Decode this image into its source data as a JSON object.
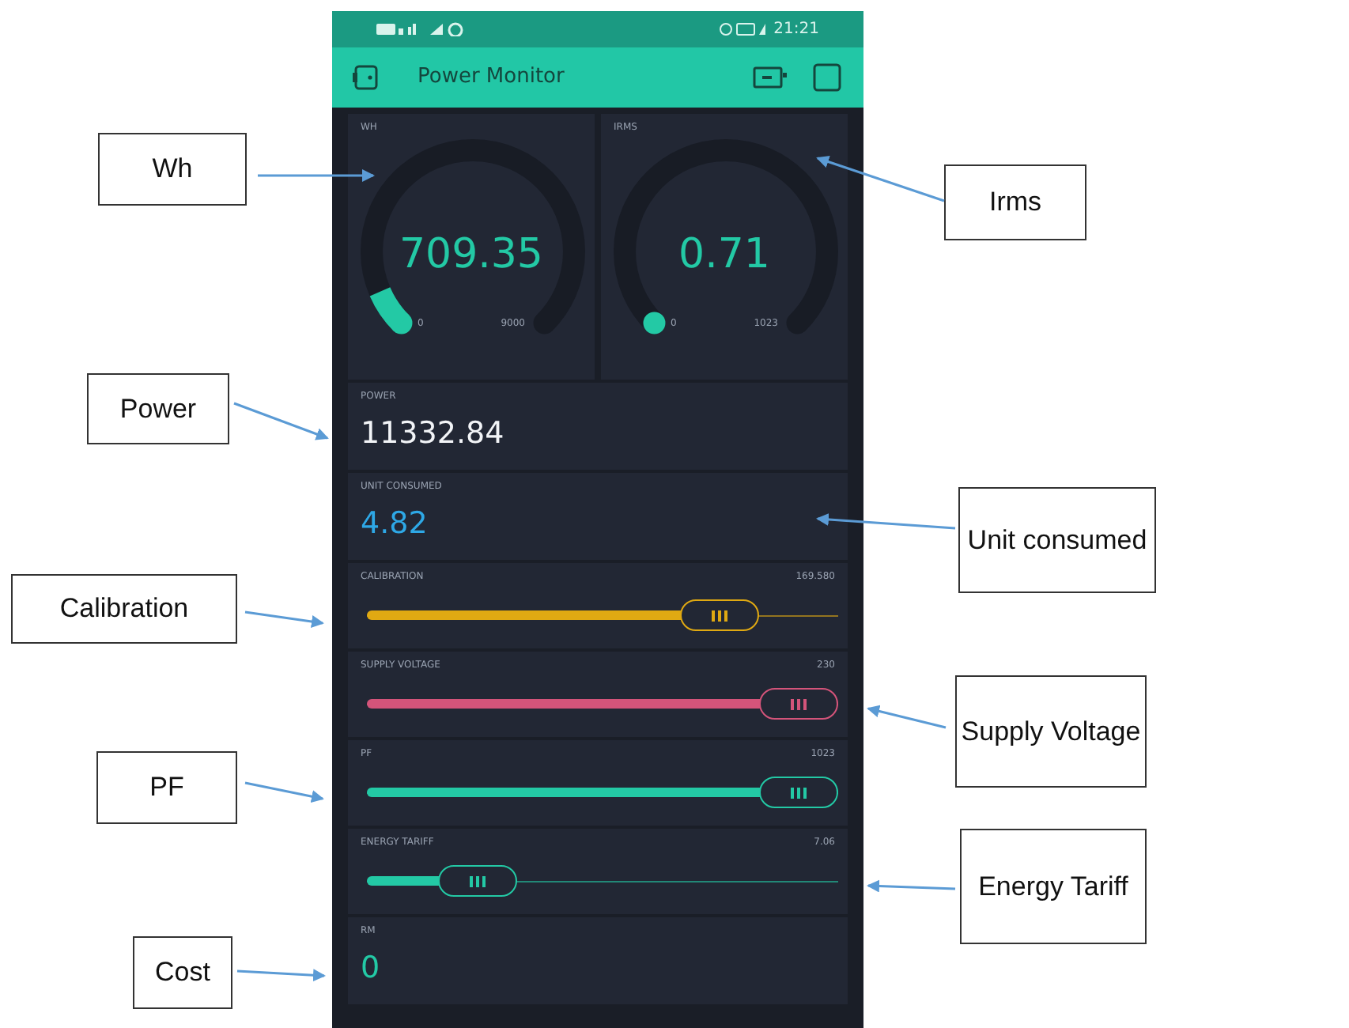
{
  "status_bar": {
    "time": "21:21"
  },
  "app_bar": {
    "title": "Power Monitor"
  },
  "widgets": [
    {
      "kind": "gauge",
      "label": "WH",
      "value": "709.35",
      "min": "0",
      "max": "9000",
      "level": 0.08
    },
    {
      "kind": "gauge",
      "label": "IRMS",
      "value": "0.71",
      "min": "0",
      "max": "1023"
    },
    {
      "kind": "value",
      "label": "POWER",
      "value": "11332.84",
      "color": "#f2f4f7"
    },
    {
      "kind": "value",
      "label": "UNIT CONSUMED",
      "value": "4.82",
      "color": "#2ea8e6"
    },
    {
      "kind": "slider",
      "label": "CALIBRATION",
      "value": "169.580",
      "level": 0.8,
      "color": "#e0a912"
    },
    {
      "kind": "slider",
      "label": "SUPPLY VOLTAGE",
      "value": "230",
      "level": 1.0,
      "color": "#d4547a"
    },
    {
      "kind": "slider",
      "label": "PF",
      "value": "1023",
      "level": 1.0,
      "color": "#23c9a5"
    },
    {
      "kind": "slider",
      "label": "ENERGY TARIFF",
      "value": "7.06",
      "level": 0.18,
      "color": "#23c9a5"
    },
    {
      "kind": "value",
      "label": "RM",
      "value": "0",
      "color": "#23c9a5"
    }
  ],
  "callouts": [
    {
      "text": "Wh"
    },
    {
      "text": "Irms"
    },
    {
      "text": "Power"
    },
    {
      "text": "Unit consumed"
    },
    {
      "text": "Calibration"
    },
    {
      "text": "Supply Voltage"
    },
    {
      "text": "PF"
    },
    {
      "text": "Energy Tariff"
    },
    {
      "text": "Cost"
    }
  ]
}
